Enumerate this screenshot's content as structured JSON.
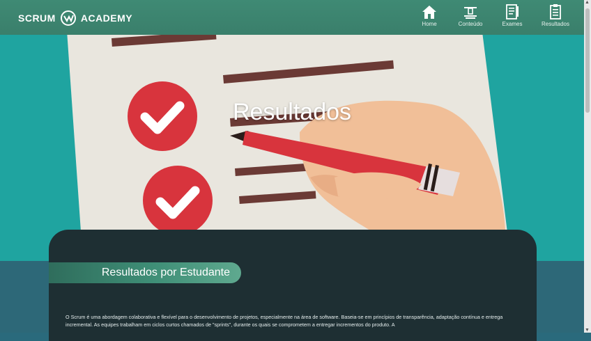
{
  "navbar": {
    "brand_left": "SCRUM",
    "brand_right": "ACADEMY",
    "items": [
      {
        "label": "Home",
        "icon": "home-icon"
      },
      {
        "label": "Conteúdo",
        "icon": "content-icon"
      },
      {
        "label": "Exames",
        "icon": "exam-icon"
      },
      {
        "label": "Resultados",
        "icon": "results-icon"
      }
    ]
  },
  "hero": {
    "title": "Resultados"
  },
  "card": {
    "section_title": "Resultados por Estudante",
    "paragraph": "O Scrum é uma abordagem colaborativa e flexível para o desenvolvimento de projetos, especialmente na área de software. Baseia-se em princípios de transparência, adaptação contínua e entrega incremental. As equipes trabalham em ciclos curtos chamados de \"sprints\", durante os quais se comprometem a entregar incrementos do produto. A"
  },
  "colors": {
    "navbar": "#3f8a74",
    "hero_bg": "#1fa4a0",
    "card_bg": "#1e2f33",
    "accent_red": "#d8343d"
  }
}
